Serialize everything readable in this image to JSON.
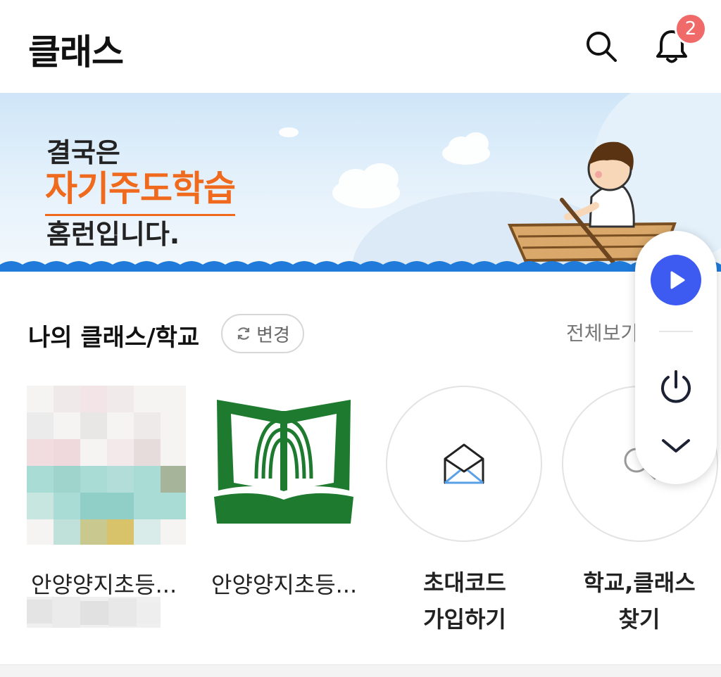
{
  "header": {
    "title": "클래스",
    "notification_count": "2"
  },
  "banner": {
    "line1": "결국은",
    "line2": "자기주도학습",
    "line3": "홈런입니다."
  },
  "section": {
    "title": "나의 클래스/학교",
    "change_label": "변경",
    "view_all_label": "전체보기"
  },
  "classes": [
    {
      "name": "안양양지초등..."
    },
    {
      "name": "안양양지초등..."
    }
  ],
  "actions": [
    {
      "line1": "초대코드",
      "line2": "가입하기"
    },
    {
      "line1": "학교,클래스",
      "line2": "찾기"
    }
  ],
  "colors": {
    "accent_orange": "#f06a1d",
    "badge_red": "#f06a6a",
    "play_blue": "#3d5af1",
    "water_blue": "#1f7ad9",
    "school_green": "#1d7a2e"
  }
}
